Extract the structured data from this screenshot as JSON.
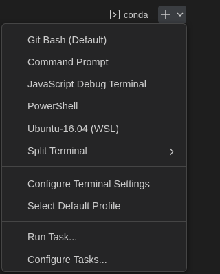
{
  "toolbar": {
    "terminal_name": "conda",
    "icons": {
      "terminal": "terminal-icon",
      "add": "plus-icon",
      "dropdown": "chevron-down-icon"
    }
  },
  "menu": {
    "group1": [
      {
        "label": "Git Bash (Default)"
      },
      {
        "label": "Command Prompt"
      },
      {
        "label": "JavaScript Debug Terminal"
      },
      {
        "label": "PowerShell"
      },
      {
        "label": "Ubuntu-16.04 (WSL)"
      },
      {
        "label": "Split Terminal",
        "submenu": true
      }
    ],
    "group2": [
      {
        "label": "Configure Terminal Settings"
      },
      {
        "label": "Select Default Profile"
      }
    ],
    "group3": [
      {
        "label": "Run Task..."
      },
      {
        "label": "Configure Tasks..."
      }
    ]
  },
  "colors": {
    "background": "#1e1e1e",
    "menu_background": "#252526",
    "border": "#454545",
    "text": "#cccccc",
    "button_active": "#3a3d41"
  }
}
